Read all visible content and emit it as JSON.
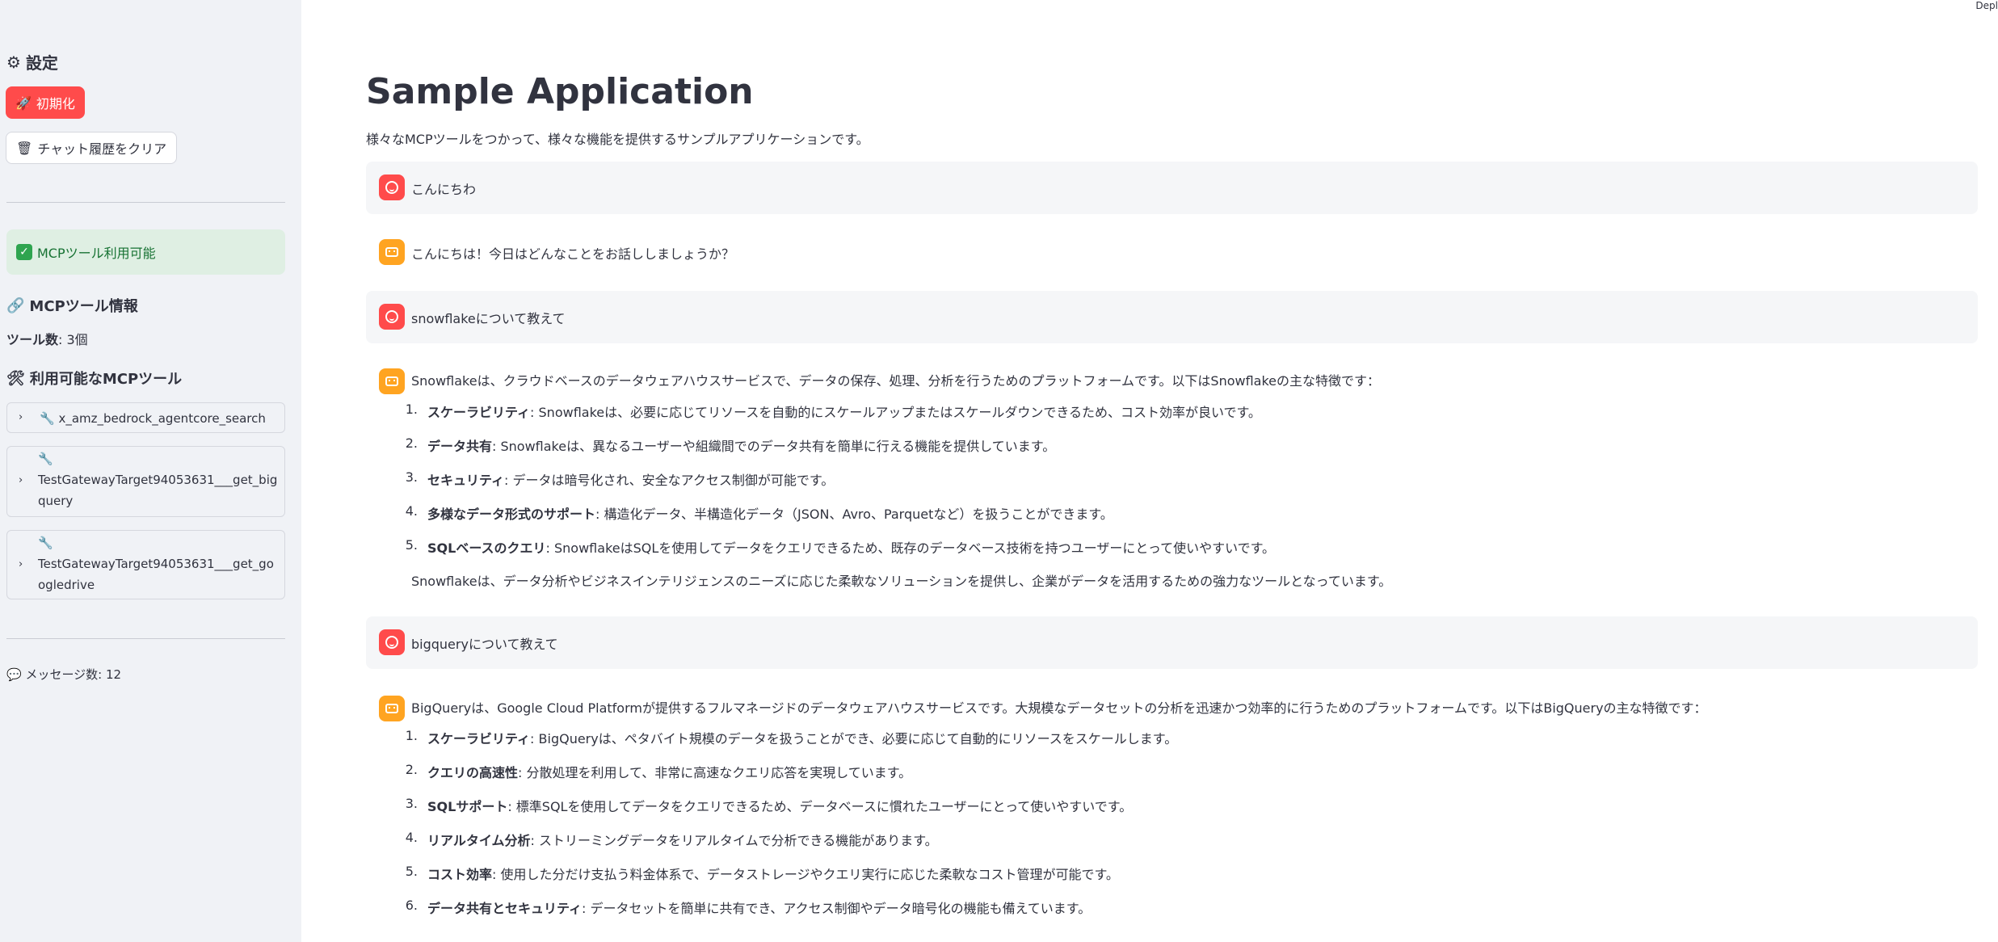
{
  "deploy_label": "Depl",
  "sidebar": {
    "header": "設定",
    "init_button": "初期化",
    "clear_button": "チャット履歴をクリア",
    "status": "MCPツール利用可能",
    "mcp_info_title": "MCPツール情報",
    "tool_count_label": "ツール数",
    "tool_count_value": ": 3個",
    "available_tools_title": "利用可能なMCPツール",
    "tools": [
      {
        "label": "x_amz_bedrock_agentcore_search"
      },
      {
        "label": "TestGatewayTarget94053631___get_bigquery"
      },
      {
        "label": "TestGatewayTarget94053631___get_googledrive"
      }
    ],
    "message_count": "メッセージ数: 12"
  },
  "main": {
    "title": "Sample Application",
    "caption": "様々なMCPツールをつかって、様々な機能を提供するサンプルアプリケーションです。",
    "messages": [
      {
        "role": "user",
        "text": "こんにちわ"
      },
      {
        "role": "assistant",
        "text": "こんにちは！今日はどんなことをお話ししましょうか？"
      },
      {
        "role": "user",
        "text": "snowflakeについて教えて"
      },
      {
        "role": "assistant",
        "intro": "Snowflakeは、クラウドベースのデータウェアハウスサービスで、データの保存、処理、分析を行うためのプラットフォームです。以下はSnowflakeの主な特徴です：",
        "items": [
          {
            "num": "1.",
            "bold": "スケーラビリティ",
            "text": ": Snowflakeは、必要に応じてリソースを自動的にスケールアップまたはスケールダウンできるため、コスト効率が良いです。"
          },
          {
            "num": "2.",
            "bold": "データ共有",
            "text": ": Snowflakeは、異なるユーザーや組織間でのデータ共有を簡単に行える機能を提供しています。"
          },
          {
            "num": "3.",
            "bold": "セキュリティ",
            "text": ": データは暗号化され、安全なアクセス制御が可能です。"
          },
          {
            "num": "4.",
            "bold": "多様なデータ形式のサポート",
            "text": ": 構造化データ、半構造化データ（JSON、Avro、Parquetなど）を扱うことができます。"
          },
          {
            "num": "5.",
            "bold": "SQLベースのクエリ",
            "text": ": SnowflakeはSQLを使用してデータをクエリできるため、既存のデータベース技術を持つユーザーにとって使いやすいです。"
          }
        ],
        "outro": "Snowflakeは、データ分析やビジネスインテリジェンスのニーズに応じた柔軟なソリューションを提供し、企業がデータを活用するための強力なツールとなっています。"
      },
      {
        "role": "user",
        "text": "bigqueryについて教えて"
      },
      {
        "role": "assistant",
        "intro": "BigQueryは、Google Cloud Platformが提供するフルマネージドのデータウェアハウスサービスです。大規模なデータセットの分析を迅速かつ効率的に行うためのプラットフォームです。以下はBigQueryの主な特徴です：",
        "items": [
          {
            "num": "1.",
            "bold": "スケーラビリティ",
            "text": ": BigQueryは、ペタバイト規模のデータを扱うことができ、必要に応じて自動的にリソースをスケールします。"
          },
          {
            "num": "2.",
            "bold": "クエリの高速性",
            "text": ": 分散処理を利用して、非常に高速なクエリ応答を実現しています。"
          },
          {
            "num": "3.",
            "bold": "SQLサポート",
            "text": ": 標準SQLを使用してデータをクエリできるため、データベースに慣れたユーザーにとって使いやすいです。"
          },
          {
            "num": "4.",
            "bold": "リアルタイム分析",
            "text": ": ストリーミングデータをリアルタイムで分析できる機能があります。"
          },
          {
            "num": "5.",
            "bold": "コスト効率",
            "text": ": 使用した分だけ支払う料金体系で、データストレージやクエリ実行に応じた柔軟なコスト管理が可能です。"
          },
          {
            "num": "6.",
            "bold": "データ共有とセキュリティ",
            "text": ": データセットを簡単に共有でき、アクセス制御やデータ暗号化の機能も備えています。"
          }
        ]
      }
    ]
  },
  "colors": {
    "primary": "#ff4b4b",
    "assistant_avatar": "#ffa421",
    "sidebar_bg": "#f0f2f6",
    "success_bg": "#dfefe3"
  },
  "icons": [
    "gear-icon",
    "rocket-icon",
    "trash-icon",
    "check-icon",
    "link-icon",
    "tools-icon",
    "wrench-icon",
    "chevron-right-icon",
    "speech-bubble-icon",
    "user-avatar-icon",
    "bot-avatar-icon"
  ]
}
